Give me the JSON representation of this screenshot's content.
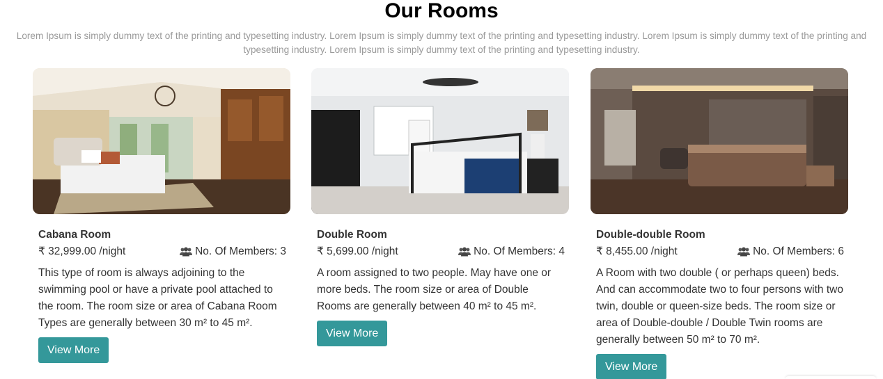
{
  "section": {
    "title": "Our Rooms",
    "subtitle": "Lorem Ipsum is simply dummy text of the printing and typesetting industry. Lorem Ipsum is simply dummy text of the printing and typesetting industry. Lorem Ipsum is simply dummy text of the printing and typesetting industry. Lorem Ipsum is simply dummy text of the printing and typesetting industry."
  },
  "rooms": [
    {
      "name": "Cabana Room",
      "price": "₹ 32,999.00 /night",
      "members": "No. Of Members: 3",
      "description": "This type of room is always adjoining to the swimming pool or have a private pool attached to the room. The room size or area of Cabana Room Types are generally between 30 m² to 45 m².",
      "button": "View More"
    },
    {
      "name": "Double Room",
      "price": "₹ 5,699.00 /night",
      "members": "No. Of Members: 4",
      "description": "A room assigned to two people. May have one or more beds. The room size or area of Double Rooms are generally between 40 m² to 45 m².",
      "button": "View More"
    },
    {
      "name": "Double-double Room",
      "price": "₹ 8,455.00 /night",
      "members": "No. Of Members: 6",
      "description": "A Room with two double ( or perhaps queen) beds. And can accommodate two to four persons with two twin, double or queen-size beds. The room size or area of Double-double / Double Twin rooms are generally between 50 m² to 70 m².",
      "button": "View More"
    }
  ],
  "colors": {
    "button": "#34989a",
    "subtitle": "#9a9a9a"
  },
  "icons": {
    "members": "users-icon"
  }
}
